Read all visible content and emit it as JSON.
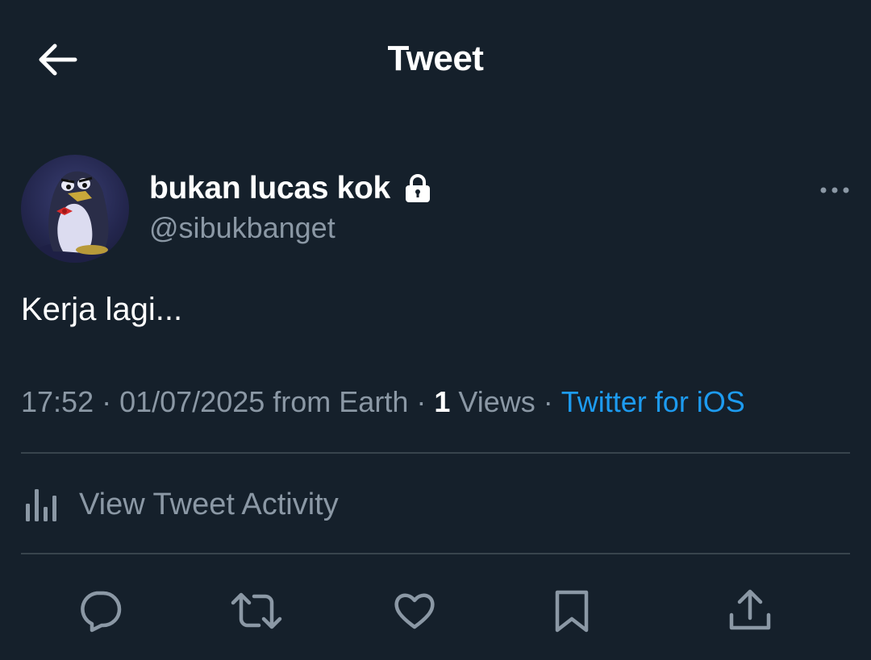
{
  "header": {
    "title": "Tweet",
    "back_icon": "arrow-left-icon"
  },
  "user": {
    "display_name": "bukan lucas kok",
    "handle": "@sibukbanget",
    "protected_icon": "lock-icon",
    "avatar_icon": "penguin-avatar"
  },
  "tweet": {
    "text": "Kerja lagi...",
    "time": "17:52",
    "date": "01/07/2025",
    "location": "from Earth",
    "views_count": "1",
    "views_label": "Views",
    "source": "Twitter for iOS",
    "separator": " · "
  },
  "activity": {
    "label": "View Tweet Activity",
    "icon": "bar-chart-icon"
  },
  "actions": {
    "reply_icon": "reply-icon",
    "retweet_icon": "retweet-icon",
    "like_icon": "heart-icon",
    "bookmark_icon": "bookmark-icon",
    "share_icon": "share-icon"
  },
  "colors": {
    "background": "#15202b",
    "text_primary": "#ffffff",
    "text_secondary": "#8b98a5",
    "accent": "#1d9bf0",
    "divider": "#38444d"
  }
}
